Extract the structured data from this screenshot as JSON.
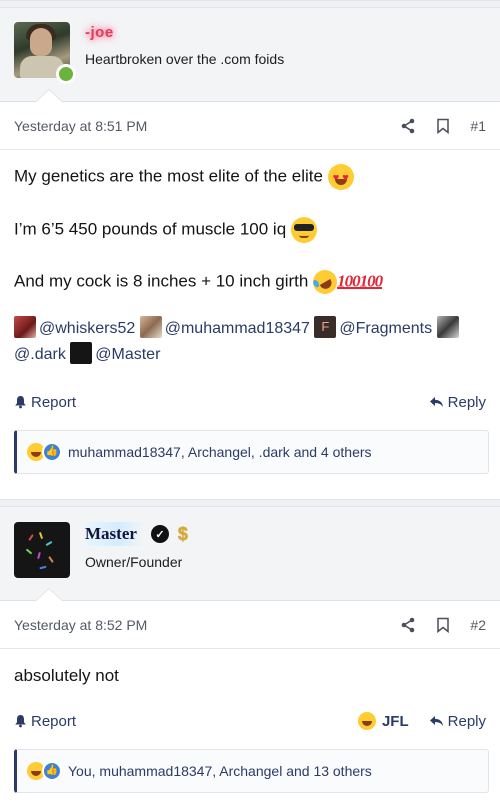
{
  "post1": {
    "user": {
      "name": "-joe",
      "title": "Heartbroken over the .com foids",
      "status": "online"
    },
    "date": "Yesterday at 8:51 PM",
    "number": "#1",
    "lines": [
      "My genetics are the most elite of the elite",
      "I’m 6’5 450 pounds of muscle 100 iq",
      "And my cock is 8 inches + 10 inch girth"
    ],
    "hundred_emoji": "100100",
    "mentions": [
      "@whiskers52",
      "@muhammad18347",
      "@Fragments",
      "@.dark",
      "@Master"
    ],
    "fragments_avatar_letter": "F",
    "actions": {
      "report": "Report",
      "reply": "Reply"
    },
    "reactions_text": "muhammad18347, Archangel, .dark and 4 others"
  },
  "post2": {
    "user": {
      "name": "Master",
      "title": "Owner/Founder",
      "badge": "$"
    },
    "date": "Yesterday at 8:52 PM",
    "number": "#2",
    "text": "absolutely not",
    "actions": {
      "report": "Report",
      "jfl": "JFL",
      "reply": "Reply"
    },
    "reactions_text": "You, muhammad18347, Archangel and 13 others"
  },
  "colors": {
    "link": "#2b3b66",
    "online": "#6cb33e",
    "username_glow": "#e03b5a",
    "dollar": "#d8a92e"
  },
  "icons": [
    "share-icon",
    "bookmark-icon",
    "bell-icon",
    "reply-arrow-icon",
    "verified-check-icon",
    "dollar-icon",
    "laughing-emoji-icon",
    "like-thumb-icon"
  ]
}
